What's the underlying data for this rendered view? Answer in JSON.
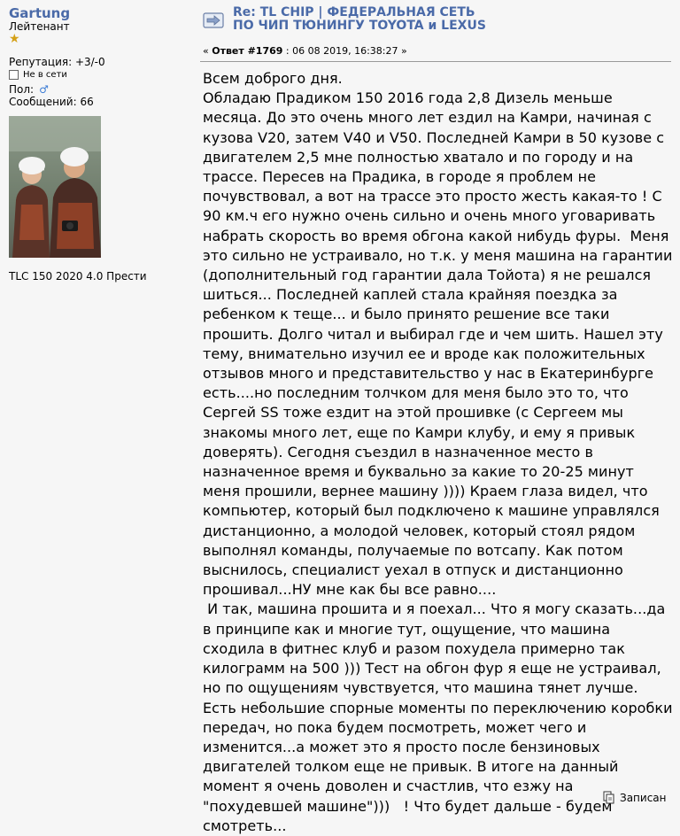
{
  "author": {
    "username": "Gartung",
    "rank": "Лейтенант",
    "rank_icon": "star-icon",
    "reputation": "Репутация: +3/-0",
    "status": "Не в сети",
    "gender_label": "Пол:",
    "gender_icon": "male-icon",
    "posts": "Сообщений: 66",
    "signature_car": "TLC 150 2020 4.0 Прести"
  },
  "post": {
    "title": "Re: TL CHIP | ФЕДЕРАЛЬНАЯ СЕТЬ ПО ЧИП ТЮНИНГУ TOYOTA и LEXUS",
    "reply_prefix": "« ",
    "reply_label": "Ответ #1769",
    "reply_date": " : 06 08 2019, 16:38:27 »",
    "body": "Всем доброго дня.\nОбладаю Прадиком 150 2016 года 2,8 Дизель меньше месяца. До это очень много лет ездил на Камри, начиная с кузова V20, затем V40 и V50. Последней Камри в 50 кузове с двигателем 2,5 мне полностью хватало и по городу и на трассе. Пересев на Прадика, в городе я проблем не почувствовал, а вот на трассе это просто жесть какая-то ! С 90 км.ч его нужно очень сильно и очень много уговаривать набрать скорость во время обгона какой нибудь фуры.  Меня это сильно не устраивало, но т.к. у меня машина на гарантии (дополнительный год гарантии дала Тойота) я не решался шиться... Последней каплей стала крайняя поездка за ребенком к теще... и было принято решение все таки прошить. Долго читал и выбирал где и чем шить. Нашел эту тему, внимательно изучил ее и вроде как положительных отзывов много и представительство у нас в Екатеринбурге есть....но последним толчком для меня было это то, что Сергей SS тоже ездит на этой прошивке (с Сергеем мы знакомы много лет, еще по Камри клубу, и ему я привык доверять). Сегодня съездил в назначенное место в назначенное время и буквально за какие то 20-25 минут меня прошили, вернее машину )))) Краем глаза видел, что компьютер, который был подключено к машине управлялся дистанционно, а молодой человек, который стоял рядом выполнял команды, получаемые по вотсапу. Как потом выснилось, специалист уехал в отпуск и дистанционно прошивал...НУ мне как бы все равно....\n И так, машина прошита и я поехал... Что я могу сказать...да в принципе как и многие тут, ощущение, что машина сходила в фитнес клуб и разом похудела примерно так килограмм на 500 ))) Тест на обгон фур я еще не устраивал, но по ощущениям чувствуется, что машина тянет лучше. Есть небольшие спорные моменты по переключению коробки передач, но пока будем посмотреть, может чего и изменится...а может это я просто после бензиновых двигателей толком еще не привык. В итоге на данный момент я очень доволен и счастлив, что езжу на \"похудевшей машине\")))   ! Что будет дальше - будем смотреть...",
    "saved_label": "Записан"
  },
  "colors": {
    "link": "#4a6aa8",
    "background": "#f6f6f6"
  }
}
